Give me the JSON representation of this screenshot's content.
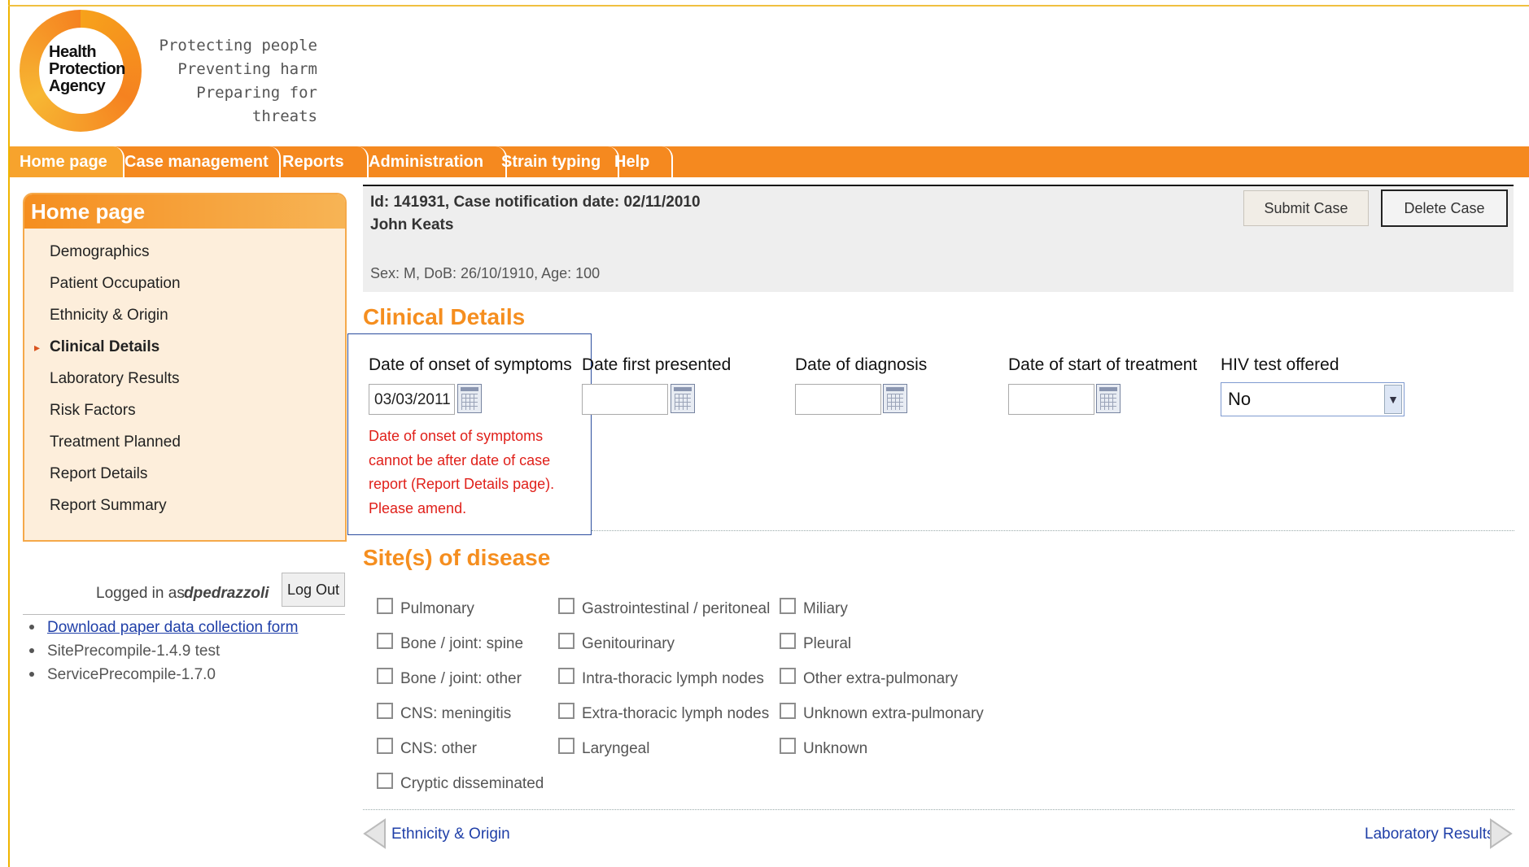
{
  "header": {
    "logo_text": [
      "Health",
      "Protection",
      "Agency"
    ],
    "tagline": [
      "Protecting people",
      "Preventing harm",
      "Preparing for threats"
    ]
  },
  "nav": {
    "tabs": [
      "Home page",
      "Case management",
      "Reports",
      "Administration",
      "Strain typing",
      "Help"
    ]
  },
  "sidebar": {
    "title": "Home page",
    "items": [
      "Demographics",
      "Patient Occupation",
      "Ethnicity & Origin",
      "Clinical Details",
      "Laboratory Results",
      "Risk Factors",
      "Treatment Planned",
      "Report Details",
      "Report Summary"
    ],
    "current_index": 3,
    "logged_in_label": "Logged in as:",
    "logged_in_user": "dpedrazzoli",
    "logout_label": "Log Out",
    "links": [
      "Download paper data collection form",
      "SitePrecompile-1.4.9 test",
      "ServicePrecompile-1.7.0"
    ]
  },
  "case": {
    "id_line": "Id: 141931, Case notification date: 02/11/2010",
    "name": "John Keats",
    "demographics": "Sex: M, DoB: 26/10/1910, Age: 100",
    "submit_label": "Submit Case",
    "delete_label": "Delete Case"
  },
  "clinical": {
    "title": "Clinical Details",
    "fields": [
      {
        "label": "Date of onset of symptoms",
        "value": "03/03/2011"
      },
      {
        "label": "Date first presented",
        "value": ""
      },
      {
        "label": "Date of diagnosis",
        "value": ""
      },
      {
        "label": "Date of start of treatment",
        "value": ""
      }
    ],
    "hiv_label": "HIV test offered",
    "hiv_value": "No",
    "error_message": "Date of onset of symptoms cannot be after date of case report (Report Details page). Please amend."
  },
  "sites": {
    "title": "Site(s) of disease",
    "col1": [
      "Pulmonary",
      "Bone / joint: spine",
      "Bone / joint: other",
      "CNS: meningitis",
      "CNS: other",
      "Cryptic disseminated"
    ],
    "col2": [
      "Gastrointestinal / peritoneal",
      "Genitourinary",
      "Intra-thoracic lymph nodes",
      "Extra-thoracic lymph nodes",
      "Laryngeal"
    ],
    "col3": [
      "Miliary",
      "Pleural",
      "Other extra-pulmonary",
      "Unknown extra-pulmonary",
      "Unknown"
    ]
  },
  "pager": {
    "prev": "Ethnicity & Origin",
    "next": "Laboratory Results"
  },
  "colors": {
    "brand_orange": "#f5891f",
    "heading_orange": "#f58e1f",
    "error_red": "#e0201a",
    "link_blue": "#1f3fa8"
  }
}
